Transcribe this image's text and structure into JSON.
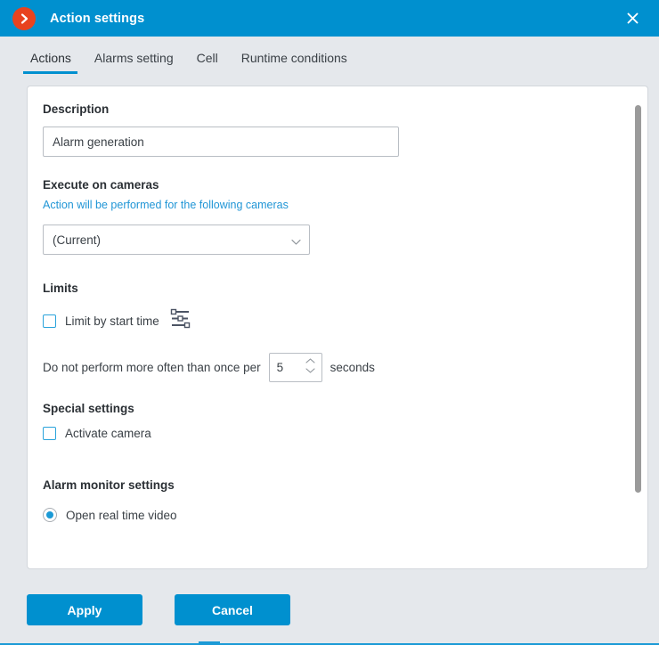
{
  "window": {
    "title": "Action settings",
    "app_icon": "chevron-right-circle-icon",
    "close_icon": "close-icon",
    "accent_color": "#0090cf",
    "badge_color": "#e8431f"
  },
  "tabs": [
    {
      "label": "Actions",
      "active": true
    },
    {
      "label": "Alarms setting",
      "active": false
    },
    {
      "label": "Cell",
      "active": false
    },
    {
      "label": "Runtime conditions",
      "active": false
    }
  ],
  "form": {
    "description": {
      "heading": "Description",
      "value": "Alarm generation",
      "placeholder": ""
    },
    "execute_on_cameras": {
      "heading": "Execute on cameras",
      "hint": "Action will be performed for the following cameras",
      "selected": "(Current)",
      "chevron_icon": "chevron-down-icon"
    },
    "limits": {
      "heading": "Limits",
      "limit_by_start_time": {
        "label": "Limit by start time",
        "checked": false,
        "icon": "sliders-icon"
      },
      "throttle": {
        "prefix": "Do not perform more often than once per",
        "value": "5",
        "suffix": "seconds",
        "up_icon": "chevron-up-icon",
        "down_icon": "chevron-down-icon"
      }
    },
    "special_settings": {
      "heading": "Special settings",
      "activate_camera": {
        "label": "Activate camera",
        "checked": false
      }
    },
    "alarm_monitor_settings": {
      "heading": "Alarm monitor settings",
      "open_real_time_video": {
        "label": "Open real time video",
        "selected": true
      }
    }
  },
  "footer": {
    "apply_label": "Apply",
    "cancel_label": "Cancel"
  }
}
